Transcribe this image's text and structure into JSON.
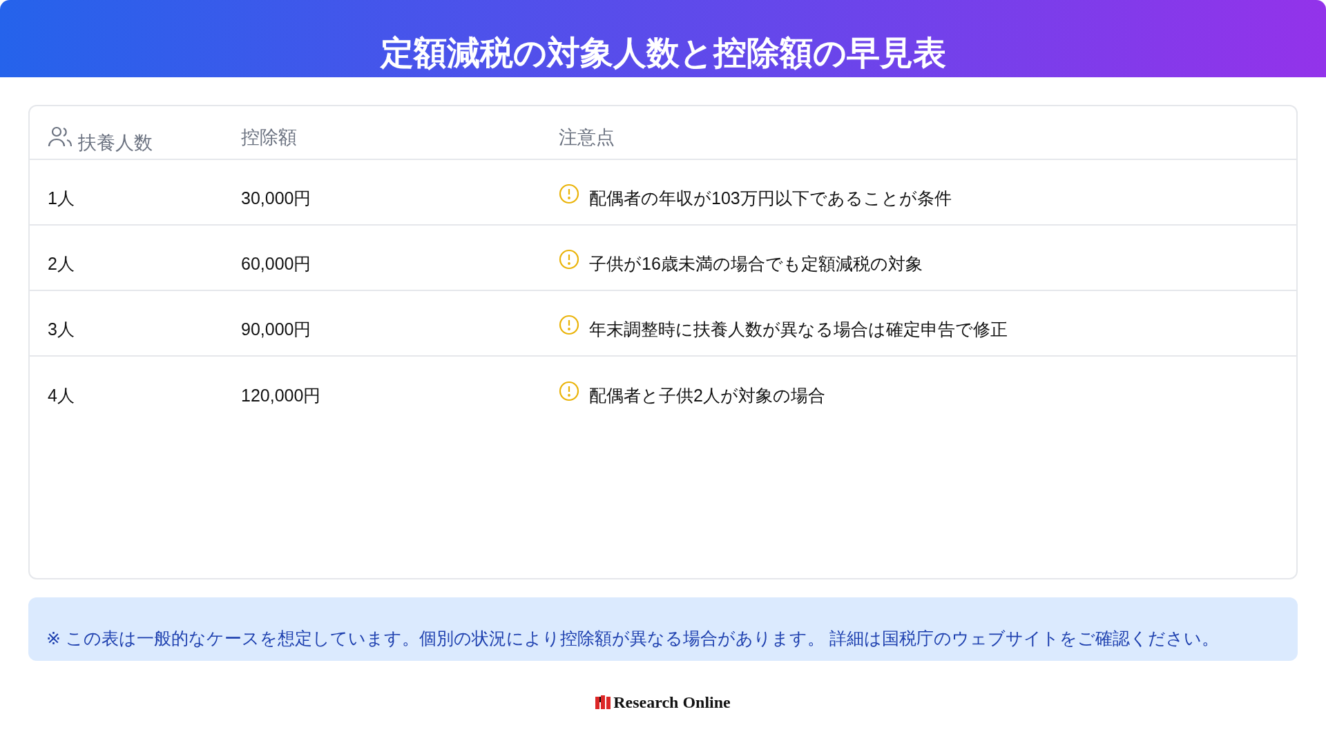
{
  "title": "定額減税の対象人数と控除額の早見表",
  "table": {
    "columns": [
      "扶養人数",
      "控除額",
      "注意点"
    ],
    "rows": [
      {
        "count": "1人",
        "amount": "30,000円",
        "note": "配偶者の年収が103万円以下であることが条件"
      },
      {
        "count": "2人",
        "amount": "60,000円",
        "note": "子供が16歳未満の場合でも定額減税の対象"
      },
      {
        "count": "3人",
        "amount": "90,000円",
        "note": "年末調整時に扶養人数が異なる場合は確定申告で修正"
      },
      {
        "count": "4人",
        "amount": "120,000円",
        "note": "配偶者と子供2人が対象の場合"
      }
    ]
  },
  "notice": "※ この表は一般的なケースを想定しています。個別の状況により控除額が異なる場合があります。 詳細は国税庁のウェブサイトをご確認ください。",
  "footer": {
    "logo_text": "Research Online"
  }
}
